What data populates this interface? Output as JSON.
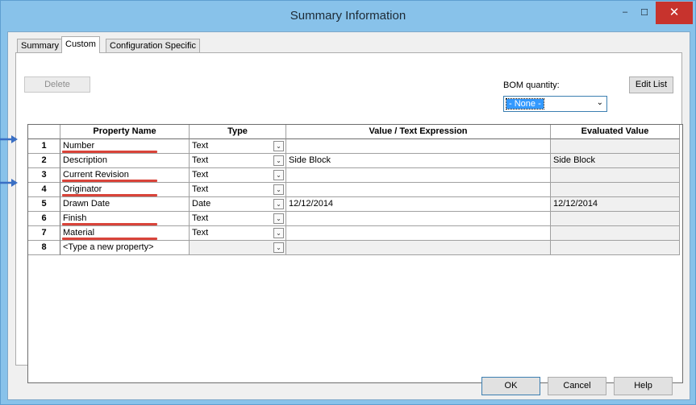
{
  "window": {
    "title": "Summary Information",
    "minimize": "–",
    "maximize": "☐",
    "close": "✕"
  },
  "tabs": [
    {
      "label": "Summary"
    },
    {
      "label": "Custom"
    },
    {
      "label": "Configuration Specific"
    }
  ],
  "toolbar": {
    "delete_label": "Delete",
    "bom_label": "BOM quantity:",
    "bom_value": "- None -",
    "edit_list_label": "Edit List"
  },
  "grid": {
    "headers": {
      "property_name": "Property Name",
      "type": "Type",
      "value": "Value / Text Expression",
      "evaluated": "Evaluated Value"
    },
    "rows": [
      {
        "num": "1",
        "name": "Number",
        "type": "Text",
        "value": "",
        "evaluated": ""
      },
      {
        "num": "2",
        "name": "Description",
        "type": "Text",
        "value": "Side Block",
        "evaluated": "Side Block"
      },
      {
        "num": "3",
        "name": "Current Revision",
        "type": "Text",
        "value": "",
        "evaluated": ""
      },
      {
        "num": "4",
        "name": "Originator",
        "type": "Text",
        "value": "",
        "evaluated": ""
      },
      {
        "num": "5",
        "name": "Drawn Date",
        "type": "Date",
        "value": "12/12/2014",
        "evaluated": "12/12/2014"
      },
      {
        "num": "6",
        "name": "Finish",
        "type": "Text",
        "value": "",
        "evaluated": ""
      },
      {
        "num": "7",
        "name": "Material",
        "type": "Text",
        "value": "",
        "evaluated": ""
      },
      {
        "num": "8",
        "name": "<Type a new property>",
        "type": "",
        "value": "",
        "evaluated": ""
      }
    ]
  },
  "footer": {
    "ok_label": "OK",
    "cancel_label": "Cancel",
    "help_label": "Help"
  },
  "colors": {
    "annotation_red": "#d9443a",
    "annotation_arrow": "#3a6fc4",
    "title_bar": "#88c2ea"
  }
}
